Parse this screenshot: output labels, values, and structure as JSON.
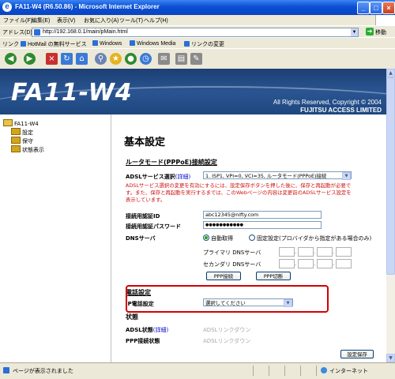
{
  "window": {
    "title": "FA11-W4 (R6.50.86) - Microsoft Internet Explorer"
  },
  "menu": [
    "ファイル(F)",
    "編集(E)",
    "表示(V)",
    "お気に入り(A)",
    "ツール(T)",
    "ヘルプ(H)"
  ],
  "address": {
    "label": "アドレス(D)",
    "url": "http://192.168.0.1/main/pMain.html",
    "go": "移動"
  },
  "links": {
    "label": "リンク",
    "items": [
      "HotMail の無料サービス",
      "Windows",
      "Windows Media",
      "リンクの変更"
    ]
  },
  "banner": {
    "logo": "FA11-W4",
    "copyright": "All Rights Reserved, Copyright © 2004",
    "company": "FUJITSU ACCESS LIMITED"
  },
  "sidebar": {
    "root": "FA11-W4",
    "items": [
      "設定",
      "保守",
      "状態表示"
    ]
  },
  "page": {
    "title": "基本設定",
    "router_section": "ルータモード(PPPoE)接続設定",
    "adsl_service_label": "ADSLサービス選択",
    "adsl_service_help": "(詳細)",
    "adsl_service_value": "1. ISP1, VPI=0, VCI=35, ルータモード(PPPoE)接続",
    "warning": "ADSLサービス選択の変更を有効にするには、設定保存ボタンを押した後に、保存と再起動が必要です。また、保存と再起動を実行するまでは、このWebページの内容は変更前のADSLサービス設定を表示しています。",
    "auth_id_label": "接続用認証ID",
    "auth_id_value": "abc12345@nifty.com",
    "auth_pw_label": "接続用認証パスワード",
    "auth_pw_value": "●●●●●●●●●●●",
    "dns_label": "DNSサーバ",
    "dns_auto": "自動取得",
    "dns_fixed": "固定設定(プロバイダから指定がある場合のみ)",
    "dns_primary": "プライマリ DNSサーバ",
    "dns_secondary": "セカンダリ DNSサーバ",
    "ppp_connect": "PPP接続",
    "ppp_disconnect": "PPP切断",
    "phone_section": "電話設定",
    "ip_phone_label": "IP電話設定",
    "ip_phone_value": "選択してください",
    "state_section": "状態",
    "adsl_state_label": "ADSL状態",
    "adsl_state_help": "(詳細)",
    "adsl_state_value": "ADSLリンクダウン",
    "ppp_state_label": "PPP接続状態",
    "ppp_state_value": "ADSLリンクダウン",
    "save": "設定保存"
  },
  "status": {
    "message": "ページが表示されました",
    "zone": "インターネット"
  },
  "colors": {
    "banner": "#1c3f74",
    "highlight": "#d40000",
    "warning": "#d01010",
    "titlebar": "#0a4fd4"
  }
}
